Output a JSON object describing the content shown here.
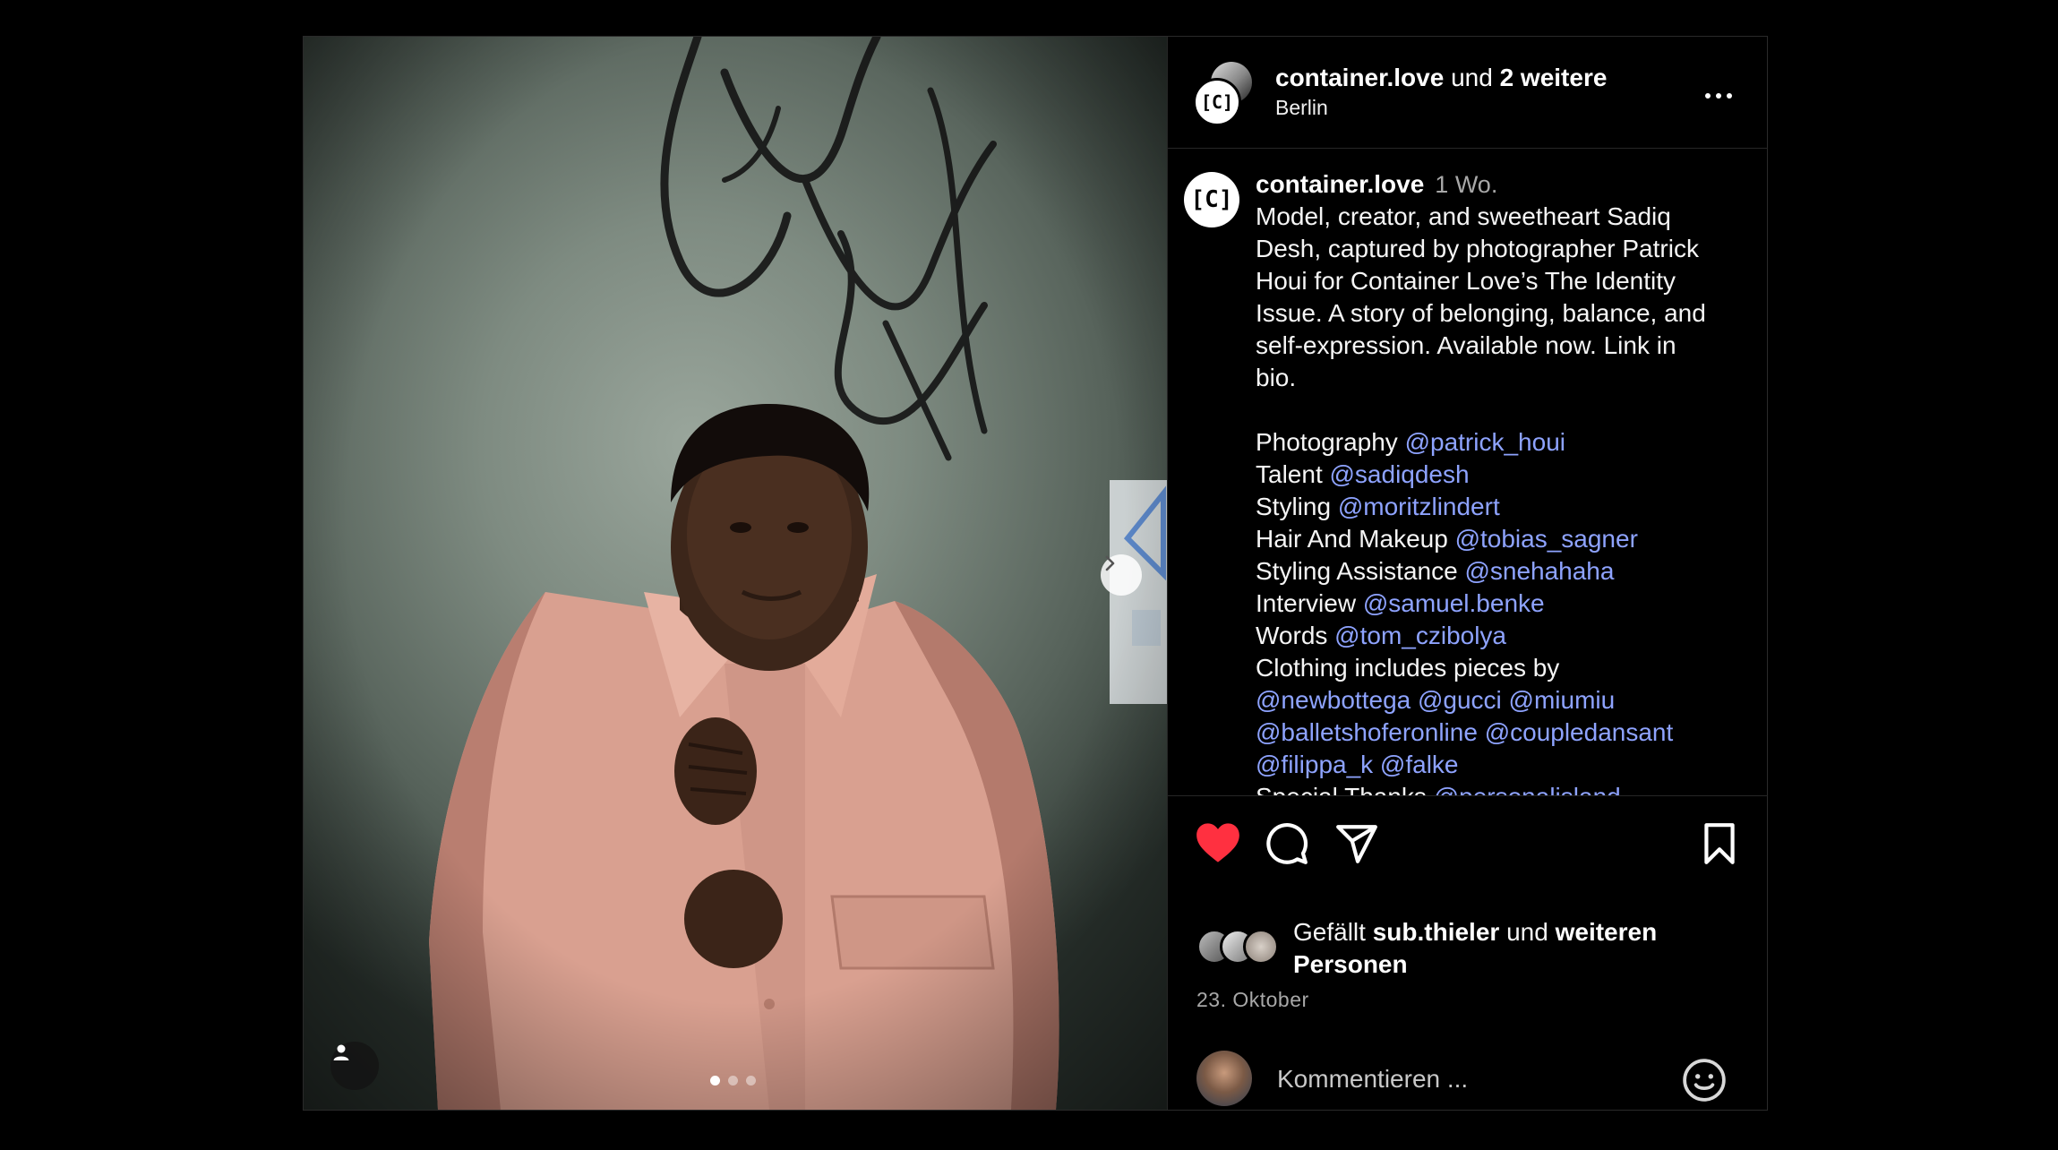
{
  "post": {
    "header": {
      "username": "container.love",
      "joiner": "und",
      "others": "2 weitere",
      "location": "Berlin",
      "avatar_text": "[C]"
    },
    "caption": {
      "avatar_text": "[C]",
      "username": "container.love",
      "time": "1 Wo.",
      "body_lines": [
        "Model, creator, and sweetheart Sadiq",
        "Desh, captured by photographer Patrick",
        "Houi for Container Love’s The Identity",
        "Issue. A story of belonging, balance, and",
        "self-expression. Available now. Link in",
        "bio."
      ],
      "credits": [
        {
          "label": "Photography",
          "mention": "@patrick_houi"
        },
        {
          "label": "Talent",
          "mention": "@sadiqdesh"
        },
        {
          "label": "Styling",
          "mention": "@moritzlindert"
        },
        {
          "label": "Hair And Makeup",
          "mention": "@tobias_sagner"
        },
        {
          "label": "Styling Assistance",
          "mention": "@snehahaha"
        },
        {
          "label": "Interview",
          "mention": "@samuel.benke"
        },
        {
          "label": "Words",
          "mention": "@tom_czibolya"
        }
      ],
      "clothing_label": "Clothing includes pieces by",
      "clothing_lines": [
        "@newbottega @gucci @miumiu",
        "@balletshoferonline @coupledansant",
        "@filippa_k @falke"
      ],
      "cutoff_label": "Special Thanks",
      "cutoff_mention": "@personalisland"
    },
    "likes": {
      "prefix": "Gefällt",
      "user": "sub.thieler",
      "joiner": "und",
      "suffix": "weiteren Personen"
    },
    "date": "23. Oktober",
    "comment_placeholder": "Kommentieren ...",
    "carousel": {
      "count": 3,
      "active": 0
    },
    "colors": {
      "like": "#ff3040",
      "mention": "#8ea3ff",
      "background": "#000000"
    }
  }
}
